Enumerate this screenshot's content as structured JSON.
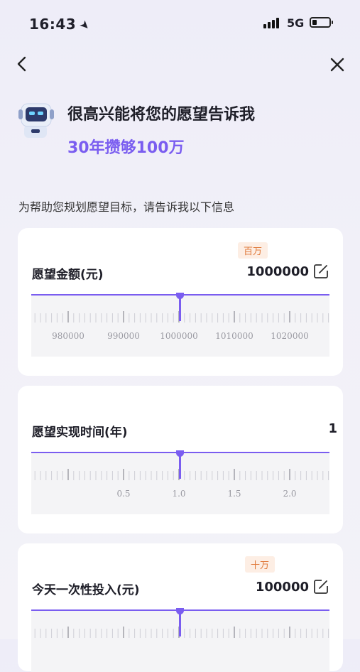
{
  "status_bar": {
    "time": "16:43",
    "network": "5G"
  },
  "header": {
    "greeting": "很高兴能将您的愿望告诉我",
    "wish": "30年攒够100万"
  },
  "intro": "为帮助您规划愿望目标，请告诉我以下信息",
  "cards": [
    {
      "label": "愿望金额(元)",
      "value": "1000000",
      "unit_badge": "百万",
      "ticks": [
        "980000",
        "990000",
        "1000000",
        "1010000",
        "1020000"
      ]
    },
    {
      "label": "愿望实现时间(年)",
      "value": "1",
      "unit_badge": "",
      "ticks": [
        "0.5",
        "1.0",
        "1.5",
        "2.0"
      ]
    },
    {
      "label": "今天一次性投入(元)",
      "value": "100000",
      "unit_badge": "十万",
      "ticks": []
    }
  ],
  "colors": {
    "accent": "#7a5df0",
    "badge_text": "#e0793a",
    "badge_bg": "#fdeee4"
  },
  "icons": {
    "back": "chevron-left-icon",
    "close": "close-icon",
    "edit": "edit-icon",
    "robot": "robot-avatar-icon",
    "location": "location-arrow-icon"
  }
}
